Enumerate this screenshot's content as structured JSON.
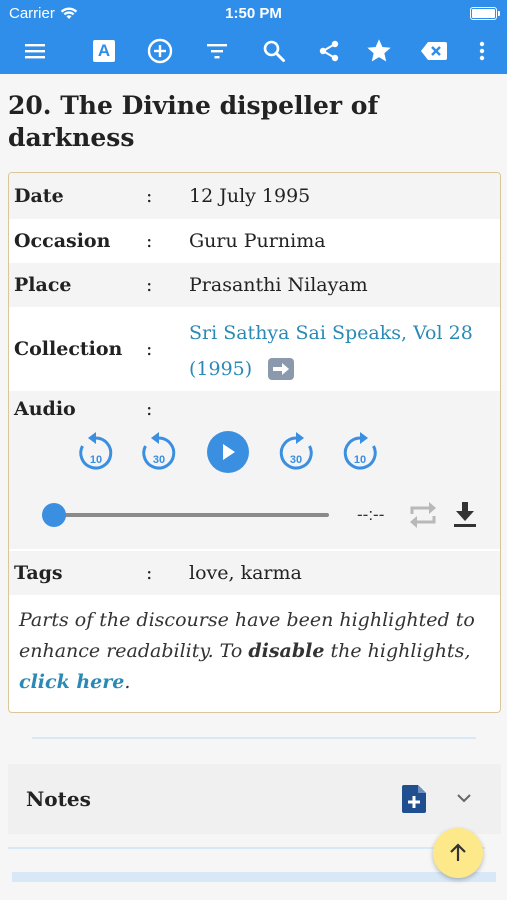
{
  "status_bar": {
    "carrier": "Carrier",
    "time": "1:50 PM",
    "battery_level": 1.0
  },
  "toolbar": {
    "icons": [
      "menu-icon",
      "font-icon",
      "add-circle-icon",
      "filter-icon",
      "search-icon",
      "share-icon",
      "star-icon",
      "clear-icon",
      "more-vert-icon"
    ],
    "font_button_label": "A"
  },
  "discourse": {
    "title": "20. The Divine dispeller of darkness",
    "info": {
      "separator": ":",
      "date_label": "Date",
      "date_value": "12 July 1995",
      "occasion_label": "Occasion",
      "occasion_value": "Guru Purnima",
      "place_label": "Place",
      "place_value": "Prasanthi Nilayam",
      "collection_label": "Collection",
      "collection_line1": "Sri Sathya Sai Speaks, Vol 28",
      "collection_line2": "(1995)",
      "audio_label": "Audio",
      "tags_label": "Tags",
      "tags_value": "love, karma"
    },
    "audio": {
      "rewind10_label": "10",
      "rewind30_label": "30",
      "forward30_label": "30",
      "forward10_label": "10",
      "time_display": "--:--",
      "progress": 0.0
    },
    "notice": {
      "text1": "Parts of the discourse have been highlighted to enhance readability. To ",
      "bold": "disable",
      "text2": " the highlights, ",
      "link": "click here",
      "end": "."
    }
  },
  "notes": {
    "label": "Notes"
  },
  "colors": {
    "primary": "#2f8eea",
    "link": "#2a8ab5",
    "border": "#d9c79a",
    "fab": "#fde98a",
    "control": "#3b8fe0"
  }
}
